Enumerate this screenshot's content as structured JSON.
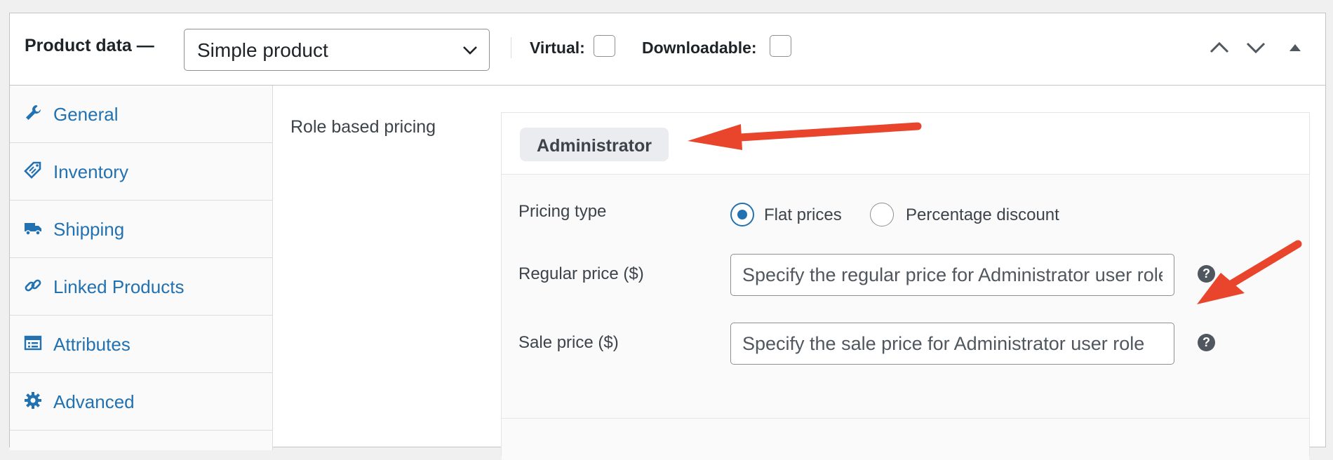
{
  "header": {
    "title": "Product data —",
    "product_type": "Simple product",
    "virtual_label": "Virtual:",
    "downloadable_label": "Downloadable:"
  },
  "sidebar": {
    "items": [
      {
        "label": "General",
        "icon": "wrench-icon"
      },
      {
        "label": "Inventory",
        "icon": "tag-icon"
      },
      {
        "label": "Shipping",
        "icon": "truck-icon"
      },
      {
        "label": "Linked Products",
        "icon": "link-icon"
      },
      {
        "label": "Attributes",
        "icon": "list-icon"
      },
      {
        "label": "Advanced",
        "icon": "gear-icon"
      }
    ]
  },
  "main": {
    "role_pricing_label": "Role based pricing",
    "role_tab": "Administrator",
    "pricing_type_label": "Pricing type",
    "pricing_options": [
      "Flat prices",
      "Percentage discount"
    ],
    "regular_price_label": "Regular price ($)",
    "regular_price_placeholder": "Specify the regular price for Administrator user role",
    "sale_price_label": "Sale price ($)",
    "sale_price_placeholder": "Specify the sale price for Administrator user role",
    "help_glyph": "?"
  },
  "colors": {
    "link": "#2271b1",
    "annotation_arrow": "#e8452c"
  }
}
